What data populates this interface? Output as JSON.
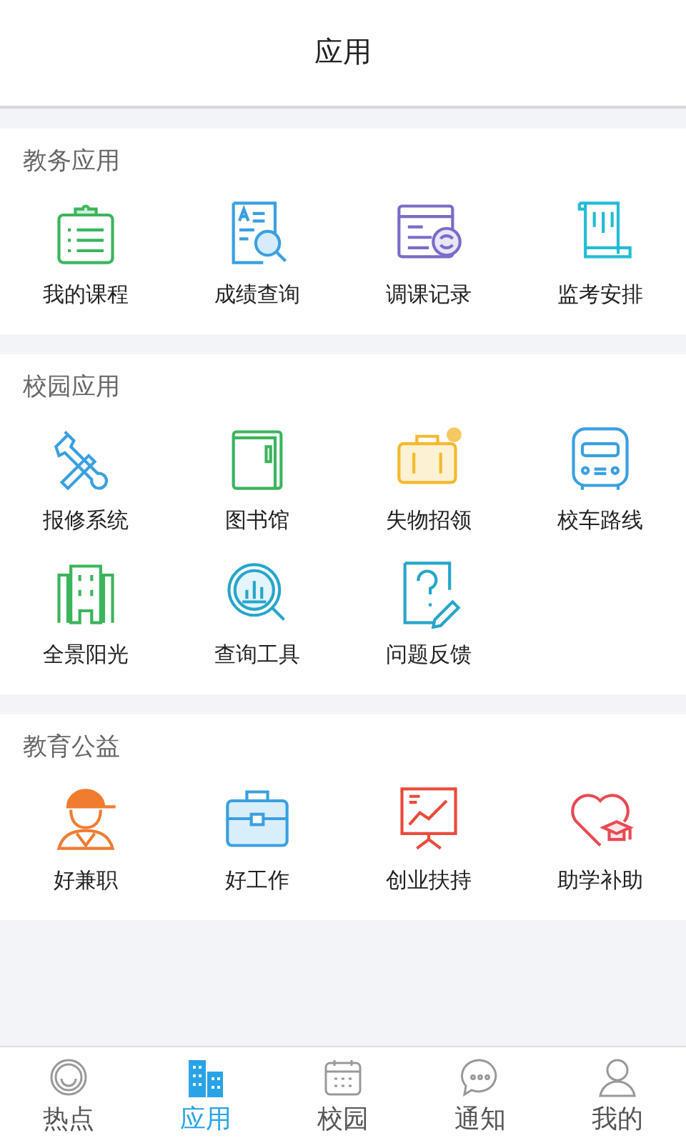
{
  "header": {
    "title": "应用"
  },
  "sections": [
    {
      "title": "教务应用",
      "items": [
        {
          "label": "我的课程",
          "kind": "clipboard"
        },
        {
          "label": "成绩查询",
          "kind": "docsearch"
        },
        {
          "label": "调课记录",
          "kind": "browser"
        },
        {
          "label": "监考安排",
          "kind": "scroll"
        }
      ]
    },
    {
      "title": "校园应用",
      "items": [
        {
          "label": "报修系统",
          "kind": "tools"
        },
        {
          "label": "图书馆",
          "kind": "book"
        },
        {
          "label": "失物招领",
          "kind": "suitcase"
        },
        {
          "label": "校车路线",
          "kind": "bus"
        },
        {
          "label": "全景阳光",
          "kind": "building"
        },
        {
          "label": "查询工具",
          "kind": "chartsearch"
        },
        {
          "label": "问题反馈",
          "kind": "question"
        }
      ]
    },
    {
      "title": "教育公益",
      "items": [
        {
          "label": "好兼职",
          "kind": "worker"
        },
        {
          "label": "好工作",
          "kind": "briefcase"
        },
        {
          "label": "创业扶持",
          "kind": "presentation"
        },
        {
          "label": "助学补助",
          "kind": "heart"
        }
      ]
    }
  ],
  "tabs": [
    {
      "label": "热点",
      "kind": "smile",
      "selected": false
    },
    {
      "label": "应用",
      "kind": "apps",
      "selected": true
    },
    {
      "label": "校园",
      "kind": "calendar",
      "selected": false
    },
    {
      "label": "通知",
      "kind": "chat",
      "selected": false
    },
    {
      "label": "我的",
      "kind": "person",
      "selected": false
    }
  ]
}
